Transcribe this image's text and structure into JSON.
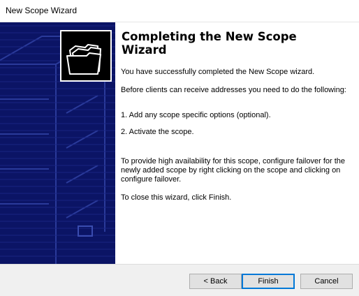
{
  "window": {
    "title": "New Scope Wizard"
  },
  "banner": {
    "icon": "folder-stack-icon"
  },
  "content": {
    "heading": "Completing the New Scope Wizard",
    "success": "You have successfully completed the New Scope wizard.",
    "intro": "Before clients can receive addresses you need to do the following:",
    "step1": "1. Add any scope specific options (optional).",
    "step2": "2. Activate the scope.",
    "failover": "To provide high availability for this scope, configure failover for the newly added scope by right clicking on the scope and clicking on configure failover.",
    "close": "To close this wizard, click Finish."
  },
  "buttons": {
    "back": "< Back",
    "finish": "Finish",
    "cancel": "Cancel"
  },
  "colors": {
    "banner": "#0b1465",
    "accent": "#0078d7"
  }
}
